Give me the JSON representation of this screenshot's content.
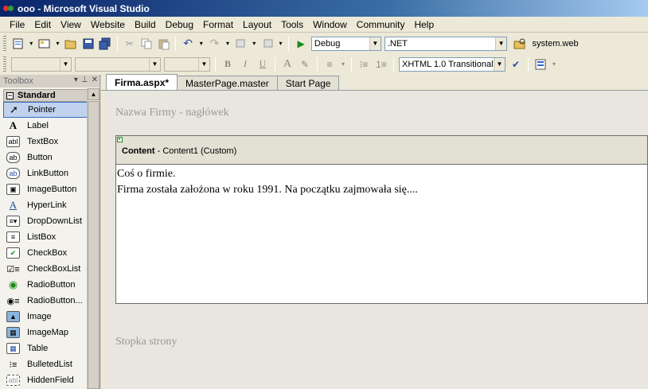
{
  "window": {
    "title": "ooo - Microsoft Visual Studio"
  },
  "menu": [
    "File",
    "Edit",
    "View",
    "Website",
    "Build",
    "Debug",
    "Format",
    "Layout",
    "Tools",
    "Window",
    "Community",
    "Help"
  ],
  "toolbar1": {
    "config": "Debug",
    "platform": ".NET",
    "startup_file": "system.web"
  },
  "toolbar2": {
    "bold": "B",
    "italic": "I",
    "underline": "U",
    "doctype": "XHTML 1.0 Transitional ("
  },
  "toolbox": {
    "title": "Toolbox",
    "category": "Standard",
    "items": [
      {
        "label": "Pointer",
        "icon": "pointer-icon"
      },
      {
        "label": "Label",
        "icon": "label-icon"
      },
      {
        "label": "TextBox",
        "icon": "textbox-icon"
      },
      {
        "label": "Button",
        "icon": "button-icon"
      },
      {
        "label": "LinkButton",
        "icon": "linkbutton-icon"
      },
      {
        "label": "ImageButton",
        "icon": "imagebutton-icon"
      },
      {
        "label": "HyperLink",
        "icon": "hyperlink-icon"
      },
      {
        "label": "DropDownList",
        "icon": "dropdownlist-icon"
      },
      {
        "label": "ListBox",
        "icon": "listbox-icon"
      },
      {
        "label": "CheckBox",
        "icon": "checkbox-icon"
      },
      {
        "label": "CheckBoxList",
        "icon": "checkboxlist-icon"
      },
      {
        "label": "RadioButton",
        "icon": "radiobutton-icon"
      },
      {
        "label": "RadioButton...",
        "icon": "radiobuttonlist-icon"
      },
      {
        "label": "Image",
        "icon": "image-icon"
      },
      {
        "label": "ImageMap",
        "icon": "imagemap-icon"
      },
      {
        "label": "Table",
        "icon": "table-icon"
      },
      {
        "label": "BulletedList",
        "icon": "bulletedlist-icon"
      },
      {
        "label": "HiddenField",
        "icon": "hiddenfield-icon"
      }
    ]
  },
  "tabs": [
    "Firma.aspx*",
    "MasterPage.master",
    "Start Page"
  ],
  "design": {
    "header": "Nazwa Firmy - nagłówek",
    "content_title": "Content",
    "content_sub": " - Content1 (Custom)",
    "line1": "Coś o firmie.",
    "line2": "Firma została założona w roku 1991. Na początku zajmowała się....",
    "footer": "Stopka strony"
  }
}
